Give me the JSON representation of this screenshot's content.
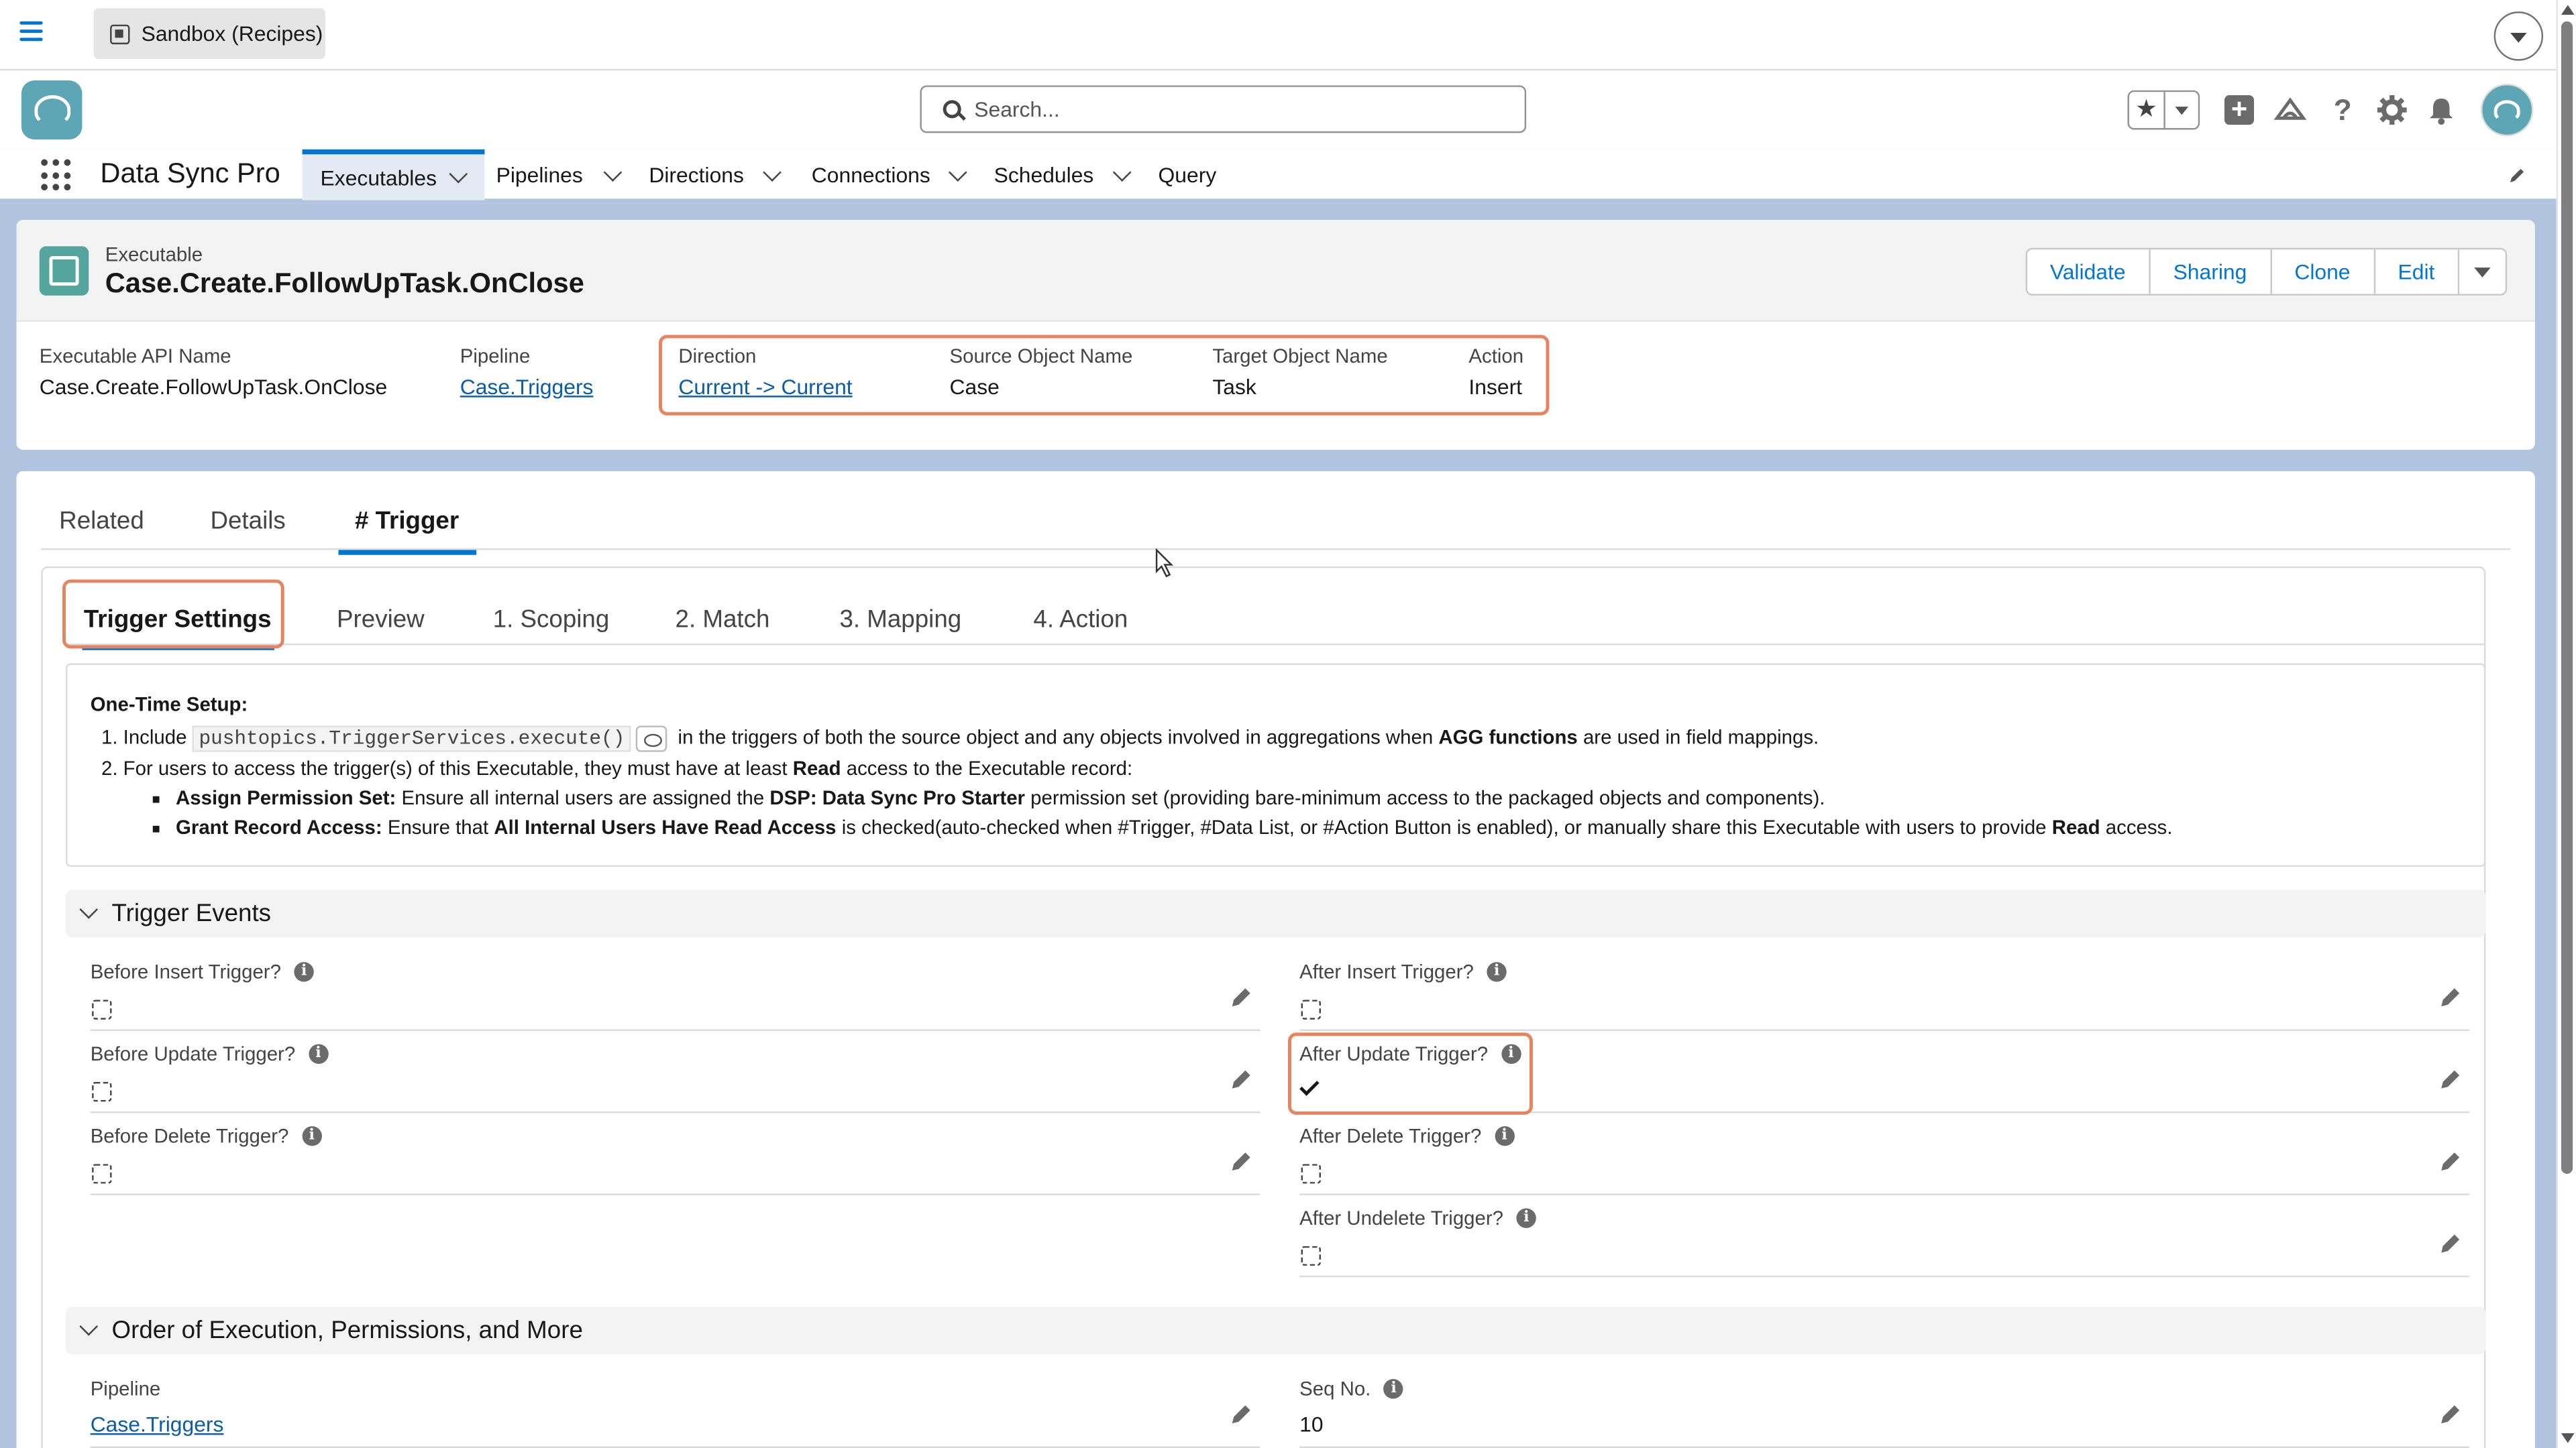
{
  "topbar": {
    "sandbox_label": "Sandbox (Recipes)"
  },
  "header": {
    "search_placeholder": "Search..."
  },
  "nav": {
    "app_name": "Data Sync Pro",
    "items": [
      "Executables",
      "Pipelines",
      "Directions",
      "Connections",
      "Schedules",
      "Query"
    ]
  },
  "record": {
    "type_label": "Executable",
    "title": "Case.Create.FollowUpTask.OnClose",
    "buttons": [
      "Validate",
      "Sharing",
      "Clone",
      "Edit"
    ],
    "fields": {
      "api_name_label": "Executable API Name",
      "api_name_value": "Case.Create.FollowUpTask.OnClose",
      "pipeline_label": "Pipeline",
      "pipeline_value": "Case.Triggers",
      "direction_label": "Direction",
      "direction_value": "Current -> Current",
      "source_label": "Source Object Name",
      "source_value": "Case",
      "target_label": "Target Object Name",
      "target_value": "Task",
      "action_label": "Action",
      "action_value": "Insert"
    }
  },
  "tabs": [
    "Related",
    "Details",
    "# Trigger"
  ],
  "subtabs": [
    "Trigger Settings",
    "Preview",
    "1. Scoping",
    "2. Match",
    "3. Mapping",
    "4. Action"
  ],
  "setup": {
    "heading": "One-Time Setup:",
    "line1_a": "Include",
    "line1_code": "pushtopics.TriggerServices.execute()",
    "line1_b": "in the triggers of both the source object and any objects involved in aggregations when",
    "line1_bold": "AGG functions",
    "line1_c": "are used in field mappings.",
    "line2_a": "For users to access the trigger(s) of this Executable, they must have at least",
    "line2_bold": "Read",
    "line2_b": "access to the Executable record:",
    "b1_bold": "Assign Permission Set:",
    "b1_a": "Ensure all internal users are assigned the",
    "b1_bold2": "DSP: Data Sync Pro Starter",
    "b1_b": "permission set (providing bare-minimum access to the packaged objects and components).",
    "b2_bold": "Grant Record Access:",
    "b2_a": "Ensure that",
    "b2_bold2": "All Internal Users Have Read Access",
    "b2_b": "is checked(auto-checked when #Trigger, #Data List, or #Action Button is enabled), or manually share this Executable with users to provide",
    "b2_bold3": "Read",
    "b2_c": "access."
  },
  "trigger_events": {
    "title": "Trigger Events",
    "left": [
      {
        "label": "Before Insert Trigger?",
        "checked": false
      },
      {
        "label": "Before Update Trigger?",
        "checked": false
      },
      {
        "label": "Before Delete Trigger?",
        "checked": false
      }
    ],
    "right": [
      {
        "label": "After Insert Trigger?",
        "checked": false
      },
      {
        "label": "After Update Trigger?",
        "checked": true
      },
      {
        "label": "After Delete Trigger?",
        "checked": false
      },
      {
        "label": "After Undelete Trigger?",
        "checked": false
      }
    ]
  },
  "order_section": {
    "title": "Order of Execution, Permissions, and More",
    "pipeline_label": "Pipeline",
    "pipeline_value": "Case.Triggers",
    "seq_label": "Seq No.",
    "seq_value": "10"
  },
  "colors": {
    "brand": "#0176d3",
    "highlight": "#e8835f",
    "logo": "#5ca6b6"
  }
}
